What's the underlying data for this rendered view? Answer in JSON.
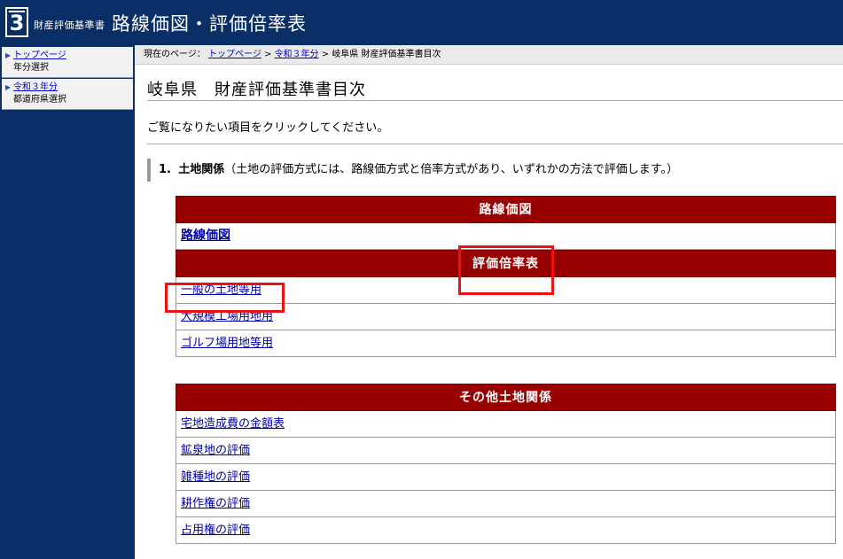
{
  "header": {
    "logo_number": "3",
    "brand_small": "財産評価基準書",
    "brand_title": "路線価図・評価倍率表"
  },
  "sidebar": {
    "items": [
      {
        "link": "トップページ",
        "sub": "年分選択"
      },
      {
        "link": "令和３年分",
        "sub": "都道府県選択"
      }
    ]
  },
  "breadcrumb": {
    "prefix": "現在のページ：",
    "link1": "トップページ",
    "sep1": " > ",
    "link2": "令和３年分",
    "sep2": " > ",
    "current": "岐阜県 財産評価基準書目次"
  },
  "main": {
    "title": "岐阜県　財産評価基準書目次",
    "intro": "ご覧になりたい項目をクリックしてください。",
    "section": {
      "number": "1.",
      "name": "土地関係",
      "note": "（土地の評価方式には、路線価方式と倍率方式があり、いずれかの方法で評価します。）"
    },
    "table1": {
      "head1": "路線価図",
      "link1": "路線価図",
      "head2": "評価倍率表",
      "links": [
        "一般の土地等用",
        "大規模工場用地用",
        "ゴルフ場用地等用"
      ]
    },
    "table2": {
      "head": "その他土地関係",
      "links": [
        "宅地造成費の金額表",
        "鉱泉地の評価",
        "雑種地の評価",
        "耕作権の評価",
        "占用権の評価"
      ]
    }
  },
  "colors": {
    "navy": "#0a2f66",
    "header_red": "#990000",
    "highlight": "#ee1111"
  }
}
